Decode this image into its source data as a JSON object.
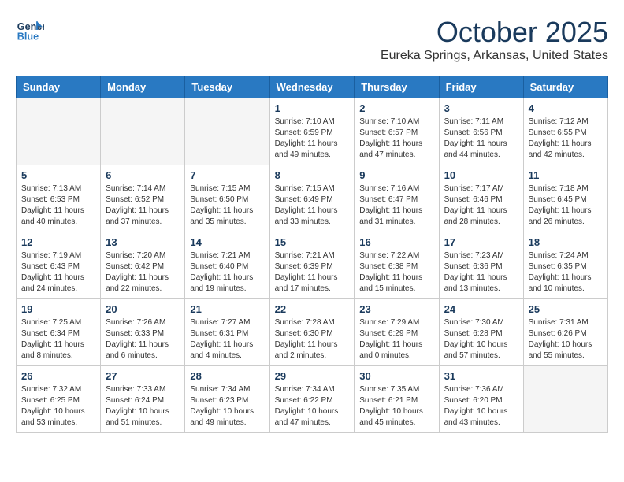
{
  "header": {
    "logo_line1": "General",
    "logo_line2": "Blue",
    "month": "October 2025",
    "location": "Eureka Springs, Arkansas, United States"
  },
  "weekdays": [
    "Sunday",
    "Monday",
    "Tuesday",
    "Wednesday",
    "Thursday",
    "Friday",
    "Saturday"
  ],
  "weeks": [
    [
      {
        "day": "",
        "info": ""
      },
      {
        "day": "",
        "info": ""
      },
      {
        "day": "",
        "info": ""
      },
      {
        "day": "1",
        "sunrise": "7:10 AM",
        "sunset": "6:59 PM",
        "daylight": "11 hours and 49 minutes."
      },
      {
        "day": "2",
        "sunrise": "7:10 AM",
        "sunset": "6:57 PM",
        "daylight": "11 hours and 47 minutes."
      },
      {
        "day": "3",
        "sunrise": "7:11 AM",
        "sunset": "6:56 PM",
        "daylight": "11 hours and 44 minutes."
      },
      {
        "day": "4",
        "sunrise": "7:12 AM",
        "sunset": "6:55 PM",
        "daylight": "11 hours and 42 minutes."
      }
    ],
    [
      {
        "day": "5",
        "sunrise": "7:13 AM",
        "sunset": "6:53 PM",
        "daylight": "11 hours and 40 minutes."
      },
      {
        "day": "6",
        "sunrise": "7:14 AM",
        "sunset": "6:52 PM",
        "daylight": "11 hours and 37 minutes."
      },
      {
        "day": "7",
        "sunrise": "7:15 AM",
        "sunset": "6:50 PM",
        "daylight": "11 hours and 35 minutes."
      },
      {
        "day": "8",
        "sunrise": "7:15 AM",
        "sunset": "6:49 PM",
        "daylight": "11 hours and 33 minutes."
      },
      {
        "day": "9",
        "sunrise": "7:16 AM",
        "sunset": "6:47 PM",
        "daylight": "11 hours and 31 minutes."
      },
      {
        "day": "10",
        "sunrise": "7:17 AM",
        "sunset": "6:46 PM",
        "daylight": "11 hours and 28 minutes."
      },
      {
        "day": "11",
        "sunrise": "7:18 AM",
        "sunset": "6:45 PM",
        "daylight": "11 hours and 26 minutes."
      }
    ],
    [
      {
        "day": "12",
        "sunrise": "7:19 AM",
        "sunset": "6:43 PM",
        "daylight": "11 hours and 24 minutes."
      },
      {
        "day": "13",
        "sunrise": "7:20 AM",
        "sunset": "6:42 PM",
        "daylight": "11 hours and 22 minutes."
      },
      {
        "day": "14",
        "sunrise": "7:21 AM",
        "sunset": "6:40 PM",
        "daylight": "11 hours and 19 minutes."
      },
      {
        "day": "15",
        "sunrise": "7:21 AM",
        "sunset": "6:39 PM",
        "daylight": "11 hours and 17 minutes."
      },
      {
        "day": "16",
        "sunrise": "7:22 AM",
        "sunset": "6:38 PM",
        "daylight": "11 hours and 15 minutes."
      },
      {
        "day": "17",
        "sunrise": "7:23 AM",
        "sunset": "6:36 PM",
        "daylight": "11 hours and 13 minutes."
      },
      {
        "day": "18",
        "sunrise": "7:24 AM",
        "sunset": "6:35 PM",
        "daylight": "11 hours and 10 minutes."
      }
    ],
    [
      {
        "day": "19",
        "sunrise": "7:25 AM",
        "sunset": "6:34 PM",
        "daylight": "11 hours and 8 minutes."
      },
      {
        "day": "20",
        "sunrise": "7:26 AM",
        "sunset": "6:33 PM",
        "daylight": "11 hours and 6 minutes."
      },
      {
        "day": "21",
        "sunrise": "7:27 AM",
        "sunset": "6:31 PM",
        "daylight": "11 hours and 4 minutes."
      },
      {
        "day": "22",
        "sunrise": "7:28 AM",
        "sunset": "6:30 PM",
        "daylight": "11 hours and 2 minutes."
      },
      {
        "day": "23",
        "sunrise": "7:29 AM",
        "sunset": "6:29 PM",
        "daylight": "11 hours and 0 minutes."
      },
      {
        "day": "24",
        "sunrise": "7:30 AM",
        "sunset": "6:28 PM",
        "daylight": "10 hours and 57 minutes."
      },
      {
        "day": "25",
        "sunrise": "7:31 AM",
        "sunset": "6:26 PM",
        "daylight": "10 hours and 55 minutes."
      }
    ],
    [
      {
        "day": "26",
        "sunrise": "7:32 AM",
        "sunset": "6:25 PM",
        "daylight": "10 hours and 53 minutes."
      },
      {
        "day": "27",
        "sunrise": "7:33 AM",
        "sunset": "6:24 PM",
        "daylight": "10 hours and 51 minutes."
      },
      {
        "day": "28",
        "sunrise": "7:34 AM",
        "sunset": "6:23 PM",
        "daylight": "10 hours and 49 minutes."
      },
      {
        "day": "29",
        "sunrise": "7:34 AM",
        "sunset": "6:22 PM",
        "daylight": "10 hours and 47 minutes."
      },
      {
        "day": "30",
        "sunrise": "7:35 AM",
        "sunset": "6:21 PM",
        "daylight": "10 hours and 45 minutes."
      },
      {
        "day": "31",
        "sunrise": "7:36 AM",
        "sunset": "6:20 PM",
        "daylight": "10 hours and 43 minutes."
      },
      {
        "day": "",
        "info": ""
      }
    ]
  ],
  "labels": {
    "sunrise_prefix": "Sunrise: ",
    "sunset_prefix": "Sunset: ",
    "daylight_prefix": "Daylight: "
  }
}
